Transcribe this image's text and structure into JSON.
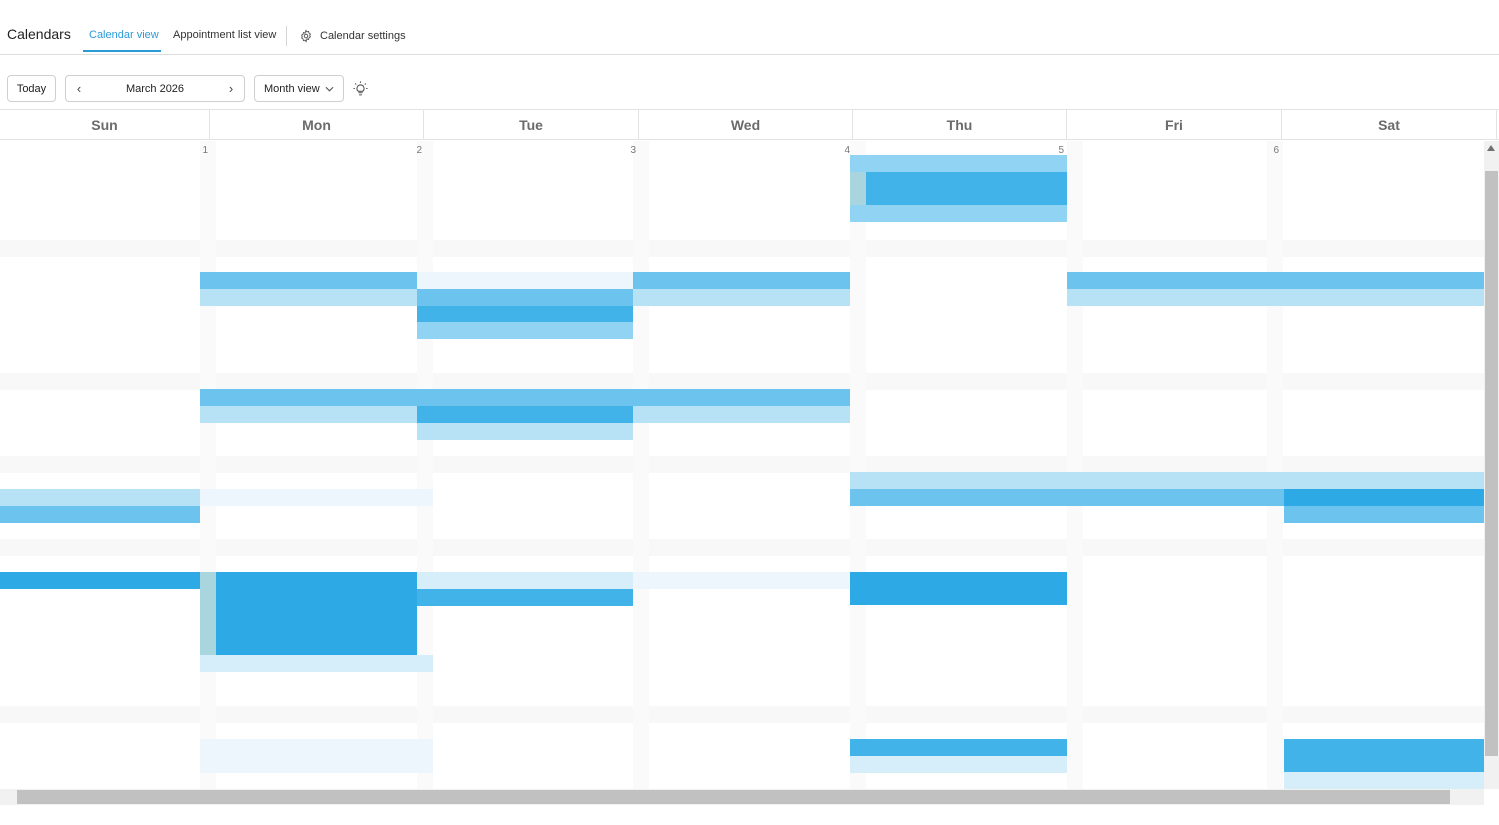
{
  "app": {
    "title": "Calendars"
  },
  "nav": {
    "tabs": [
      {
        "label": "Calendar view",
        "active": true
      },
      {
        "label": "Appointment list view",
        "active": false
      }
    ],
    "settings": {
      "label": "Calendar settings",
      "icon": "gear-icon"
    }
  },
  "toolbar": {
    "today_label": "Today",
    "month_label": "March 2026",
    "prev_icon": "chevron-left-icon",
    "next_icon": "chevron-right-icon",
    "view_label": "Month view",
    "view_icon": "chevron-down-icon",
    "hint_icon": "lightbulb-icon"
  },
  "calendar": {
    "weekdays": [
      "Sun",
      "Mon",
      "Tue",
      "Wed",
      "Thu",
      "Fri",
      "Sat"
    ],
    "first_week_dates": [
      "1",
      "2",
      "3",
      "4",
      "5",
      "6"
    ]
  },
  "colors": {
    "accent": "#2b9bd6",
    "event_strong": "#2daae6",
    "event_light": "#b7e2f6"
  }
}
